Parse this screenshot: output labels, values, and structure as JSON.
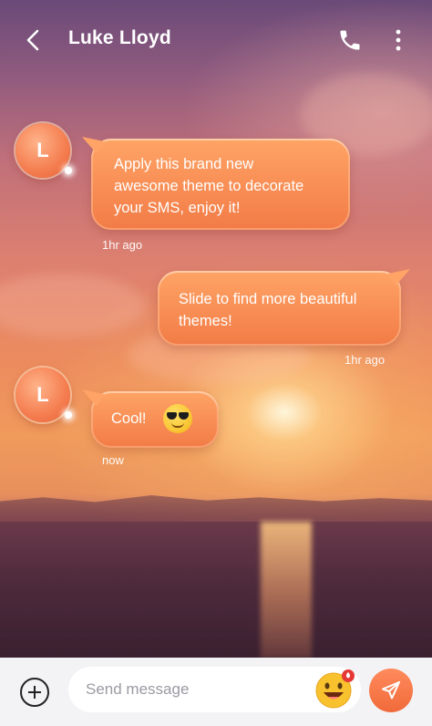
{
  "header": {
    "contact_name": "Luke Lloyd",
    "icons": [
      "back-arrow-icon",
      "phone-icon",
      "more-vertical-icon"
    ]
  },
  "messages": [
    {
      "side": "incoming",
      "avatar_letter": "L",
      "text_lines": [
        "Apply this brand new",
        "awesome theme to decorate",
        "your SMS, enjoy it!"
      ],
      "time": "1hr ago"
    },
    {
      "side": "outgoing",
      "text_lines": [
        "Slide to find more beautiful",
        "themes!"
      ],
      "time": "1hr ago"
    },
    {
      "side": "incoming",
      "avatar_letter": "L",
      "text": "Cool!",
      "emoji": "smiling-face-with-sunglasses-icon",
      "time": "now"
    }
  ],
  "composer": {
    "placeholder": "Send message",
    "icons": [
      "plus-circle-icon",
      "emoji-icon",
      "send-icon"
    ]
  },
  "colors": {
    "bubble": "#f27b46",
    "send_button": "#f06a3a",
    "text_light": "#ffffff"
  }
}
